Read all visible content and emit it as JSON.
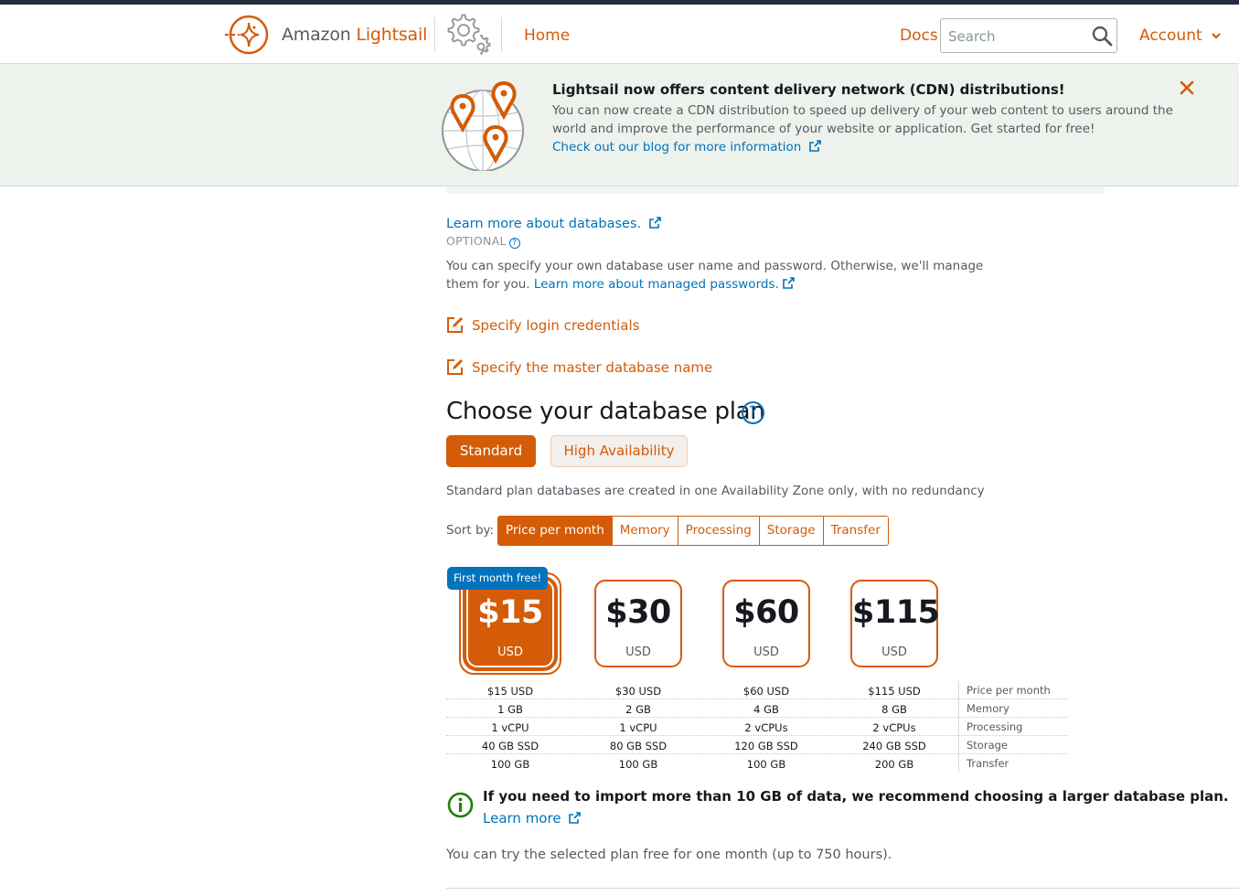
{
  "header": {
    "brand_prefix": "Amazon",
    "brand_name": "Lightsail",
    "home_label": "Home",
    "docs_label": "Docs",
    "search_placeholder": "Search",
    "account_label": "Account"
  },
  "banner": {
    "title": "Lightsail now offers content delivery network (CDN) distributions!",
    "text": "You can now create a CDN distribution to speed up delivery of your web content to users around the world and improve the performance of your website or application. Get started for free!",
    "link": "Check out our blog for more information"
  },
  "database": {
    "learn_more": "Learn more about databases.",
    "optional": "OPTIONAL",
    "description": "You can specify your own database user name and password. Otherwise, we'll manage them for you.",
    "managed_link": "Learn more about managed passwords.",
    "login_credentials": "Specify login credentials",
    "master_name": "Specify the master database name"
  },
  "plan": {
    "title": "Choose your database plan",
    "help": "?",
    "standard_label": "Standard",
    "ha_label": "High Availability",
    "standard_note": "Standard plan databases are created in one Availability Zone only, with no redundancy",
    "sort_label": "Sort by:",
    "sort_options": [
      "Price per month",
      "Memory",
      "Processing",
      "Storage",
      "Transfer"
    ],
    "free_badge": "First month free!",
    "cards": [
      {
        "price": "$15",
        "currency": "USD"
      },
      {
        "price": "$30",
        "currency": "USD"
      },
      {
        "price": "$60",
        "currency": "USD"
      },
      {
        "price": "$115",
        "currency": "USD"
      }
    ],
    "spec_labels": [
      "Price per month",
      "Memory",
      "Processing",
      "Storage",
      "Transfer"
    ],
    "specs": [
      [
        "$15 USD",
        "$30 USD",
        "$60 USD",
        "$115 USD"
      ],
      [
        "1 GB",
        "2 GB",
        "4 GB",
        "8 GB"
      ],
      [
        "1 vCPU",
        "1 vCPU",
        "2 vCPUs",
        "2 vCPUs"
      ],
      [
        "40 GB SSD",
        "80 GB SSD",
        "120 GB SSD",
        "240 GB SSD"
      ],
      [
        "100 GB",
        "100 GB",
        "100 GB",
        "200 GB"
      ]
    ],
    "import_note": "If you need to import more than 10 GB of data, we recommend choosing a larger database plan.",
    "import_link": "Learn more",
    "free_trial_note": "You can try the selected plan free for one month (up to 750 hours)."
  },
  "colors": {
    "brand_orange": "#d45b07",
    "link_blue": "#0073bb",
    "banner_bg": "#eef2ec"
  }
}
